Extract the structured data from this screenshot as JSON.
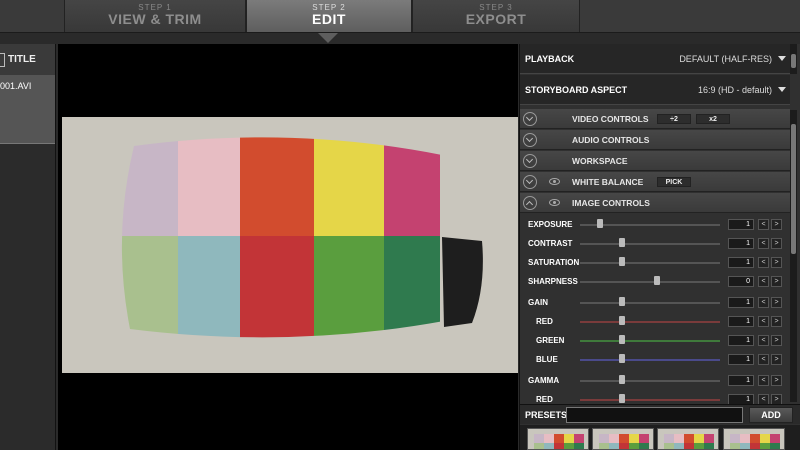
{
  "steps": [
    {
      "num": "STEP 1",
      "name": "VIEW & TRIM",
      "active": false
    },
    {
      "num": "STEP 2",
      "name": "EDIT",
      "active": true
    },
    {
      "num": "STEP 3",
      "name": "EXPORT",
      "active": false
    }
  ],
  "file_panel": {
    "header": "TITLE",
    "file_name": "001.AVI"
  },
  "settings": {
    "playback": {
      "label": "PLAYBACK",
      "value": "DEFAULT (HALF-RES)"
    },
    "storyboard": {
      "label": "STORYBOARD ASPECT",
      "value": "16:9 (HD - default)"
    }
  },
  "sections": {
    "video_controls": "VIDEO CONTROLS",
    "video_btn_1": "÷2",
    "video_btn_2": "x2",
    "audio_controls": "AUDIO CONTROLS",
    "workspace": "WORKSPACE",
    "white_balance": "WHITE BALANCE",
    "pick": "PICK",
    "image_controls": "IMAGE CONTROLS"
  },
  "sliders": [
    {
      "label": "EXPOSURE",
      "value": "1",
      "level": 0.14,
      "indent": false,
      "track": "#555555"
    },
    {
      "label": "CONTRAST",
      "value": "1",
      "level": 0.3,
      "indent": false,
      "track": "#555555"
    },
    {
      "label": "SATURATION",
      "value": "1",
      "level": 0.3,
      "indent": false,
      "track": "#555555"
    },
    {
      "label": "SHARPNESS",
      "value": "0",
      "level": 0.55,
      "indent": false,
      "track": "#555555"
    },
    {
      "label": "GAIN",
      "value": "1",
      "level": 0.3,
      "indent": false,
      "track": "#555555"
    },
    {
      "label": "RED",
      "value": "1",
      "level": 0.3,
      "indent": true,
      "track": "#7a3b3b"
    },
    {
      "label": "GREEN",
      "value": "1",
      "level": 0.3,
      "indent": true,
      "track": "#3f7a3b"
    },
    {
      "label": "BLUE",
      "value": "1",
      "level": 0.3,
      "indent": true,
      "track": "#4a4a8a"
    },
    {
      "label": "GAMMA",
      "value": "1",
      "level": 0.3,
      "indent": false,
      "track": "#555555"
    },
    {
      "label": "RED",
      "value": "1",
      "level": 0.3,
      "indent": true,
      "track": "#7a3b3b"
    }
  ],
  "stepper": {
    "dec": "<",
    "inc": ">"
  },
  "presets": {
    "label": "PRESETS",
    "add": "ADD"
  },
  "colors": {
    "top_row": [
      "#c7b6c6",
      "#e7bdc3",
      "#d24c2e",
      "#e5d648",
      "#c44270",
      "#c9c6bd"
    ],
    "bottom_row": [
      "#a9c08e",
      "#8fb8bd",
      "#c23437",
      "#5a9e3e",
      "#2f7a4e",
      "#202020"
    ]
  }
}
